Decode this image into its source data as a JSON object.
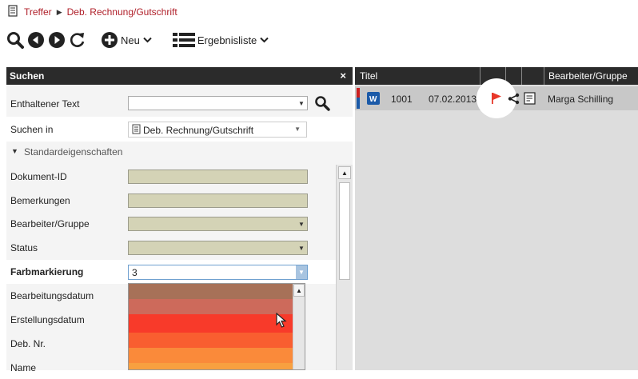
{
  "breadcrumb": {
    "root": "Treffer",
    "current": "Deb. Rechnung/Gutschrift"
  },
  "toolbar": {
    "new_label": "Neu",
    "results_label": "Ergebnisliste"
  },
  "search_panel": {
    "title": "Suchen",
    "close": "×",
    "contained_text_label": "Enthaltener Text",
    "search_in_label": "Suchen in",
    "search_in_value": "Deb. Rechnung/Gutschrift",
    "section_label": "Standardeigenschaften",
    "fields": [
      {
        "label": "Dokument-ID"
      },
      {
        "label": "Bemerkungen"
      },
      {
        "label": "Bearbeiter/Gruppe"
      },
      {
        "label": "Status"
      },
      {
        "label": "Farbmarkierung",
        "value": "3"
      },
      {
        "label": "Bearbeitungsdatum"
      },
      {
        "label": "Erstellungsdatum"
      },
      {
        "label": "Deb. Nr."
      },
      {
        "label": "Name"
      }
    ],
    "color_options": [
      "#a77158",
      "#cd6a5b",
      "#f83a2a",
      "#f95e30",
      "#fa8a3a",
      "#f8a040"
    ]
  },
  "results": {
    "columns": {
      "title": "Titel",
      "editor": "Bearbeiter/Gruppe"
    },
    "row": {
      "number": "1001",
      "date": "07.02.2013",
      "editor": "Marga Schilling",
      "flag_color": "#e8382a",
      "mark_color": "#1b5aa8"
    }
  }
}
